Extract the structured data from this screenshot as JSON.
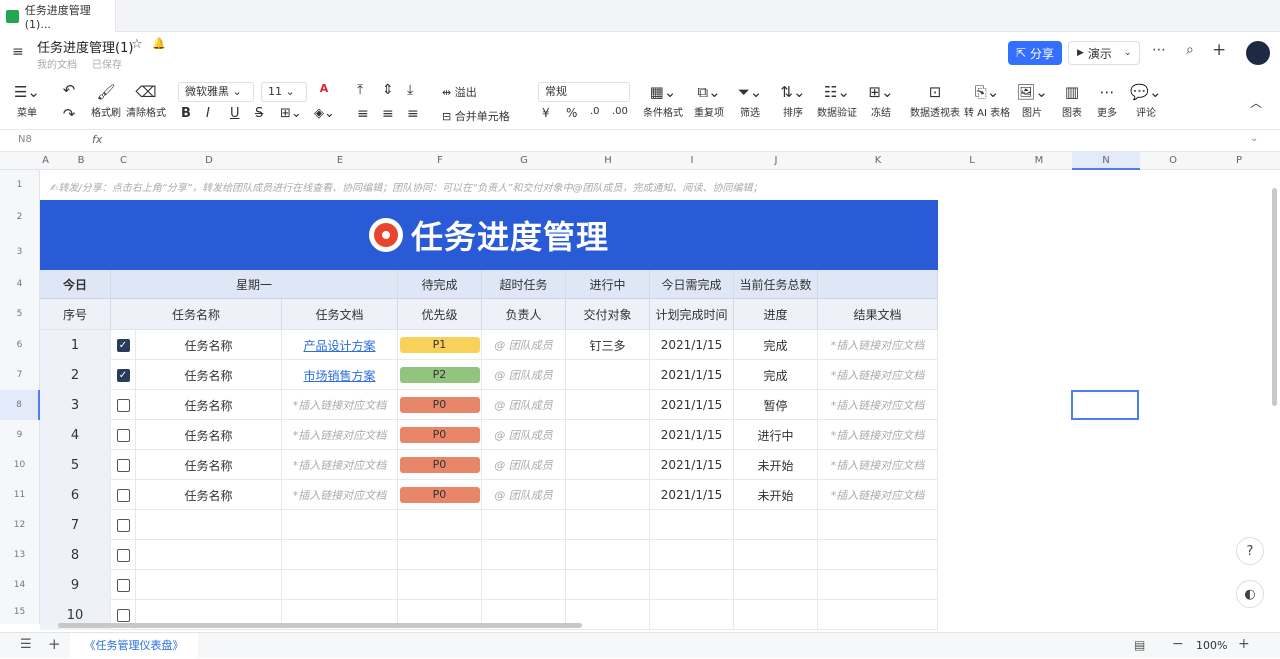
{
  "tab": {
    "title": "任务进度管理(1)..."
  },
  "header": {
    "title": "任务进度管理(1)",
    "location": "我的文档",
    "saved": "已保存",
    "share_label": "分享",
    "present_label": "演示"
  },
  "toolbar": {
    "menu": "菜单",
    "format_painter": "格式刷",
    "clear_format": "清除格式",
    "font_name": "微软雅黑",
    "font_size": "11",
    "overflow": "溢出",
    "merge": "合并单元格",
    "number_format": "常规",
    "cond_format": "条件格式",
    "dup": "重复项",
    "filter": "筛选",
    "sort": "排序",
    "validation": "数据验证",
    "freeze": "冻结",
    "pivot": "数据透视表",
    "ai_table": "转 AI 表格",
    "image": "图片",
    "chart": "图表",
    "more": "更多",
    "comment": "评论"
  },
  "formula_bar": {
    "cell_ref": "N8",
    "fx": "fx"
  },
  "columns": [
    "A",
    "B",
    "C",
    "D",
    "E",
    "F",
    "G",
    "H",
    "I",
    "J",
    "K",
    "L",
    "M",
    "N",
    "O",
    "P"
  ],
  "rows": [
    "1",
    "2",
    "3",
    "4",
    "5",
    "6",
    "7",
    "8",
    "9",
    "10",
    "11",
    "12",
    "13",
    "14",
    "15"
  ],
  "sheet": {
    "notice": "✍转发/分享：点击右上角“分享”，转发给团队成员进行在线查看、协同编辑；团队协同：可以在“负责人”和交付对象中@团队成员，完成通知、阅读、协同编辑；",
    "banner_title": "任务进度管理",
    "summary": {
      "today": "今日",
      "weekday": "星期一",
      "pending": "待完成",
      "overdue": "超时任务",
      "in_progress": "进行中",
      "due_today": "今日需完成",
      "total": "当前任务总数"
    },
    "headers": {
      "seq": "序号",
      "name": "任务名称",
      "doc": "任务文档",
      "priority": "优先级",
      "owner": "负责人",
      "deliver": "交付对象",
      "plan_date": "计划完成时间",
      "progress": "进度",
      "result": "结果文档"
    },
    "tasks": [
      {
        "seq": "1",
        "checked": true,
        "name": "任务名称",
        "doc": "产品设计方案",
        "priority": "P1",
        "owner": "@ 团队成员",
        "deliver": "钉三多",
        "date": "2021/1/15",
        "progress": "完成",
        "result": "*插入链接对应文档"
      },
      {
        "seq": "2",
        "checked": true,
        "name": "任务名称",
        "doc": "市场销售方案",
        "priority": "P2",
        "owner": "@ 团队成员",
        "deliver": "",
        "date": "2021/1/15",
        "progress": "完成",
        "result": "*插入链接对应文档"
      },
      {
        "seq": "3",
        "checked": false,
        "name": "任务名称",
        "doc": "*插入链接对应文档",
        "priority": "P0",
        "owner": "@ 团队成员",
        "deliver": "",
        "date": "2021/1/15",
        "progress": "暂停",
        "result": "*插入链接对应文档"
      },
      {
        "seq": "4",
        "checked": false,
        "name": "任务名称",
        "doc": "*插入链接对应文档",
        "priority": "P0",
        "owner": "@ 团队成员",
        "deliver": "",
        "date": "2021/1/15",
        "progress": "进行中",
        "result": "*插入链接对应文档"
      },
      {
        "seq": "5",
        "checked": false,
        "name": "任务名称",
        "doc": "*插入链接对应文档",
        "priority": "P0",
        "owner": "@ 团队成员",
        "deliver": "",
        "date": "2021/1/15",
        "progress": "未开始",
        "result": "*插入链接对应文档"
      },
      {
        "seq": "6",
        "checked": false,
        "name": "任务名称",
        "doc": "*插入链接对应文档",
        "priority": "P0",
        "owner": "@ 团队成员",
        "deliver": "",
        "date": "2021/1/15",
        "progress": "未开始",
        "result": "*插入链接对应文档"
      },
      {
        "seq": "7",
        "checked": false
      },
      {
        "seq": "8",
        "checked": false
      },
      {
        "seq": "9",
        "checked": false
      },
      {
        "seq": "10",
        "checked": false
      }
    ],
    "priority_colors": {
      "P0": "#e8866a",
      "P1": "#f8d15a",
      "P2": "#93c47d"
    }
  },
  "bottom": {
    "sheet_tab": "《任务管理仪表盘》",
    "zoom": "100%"
  }
}
